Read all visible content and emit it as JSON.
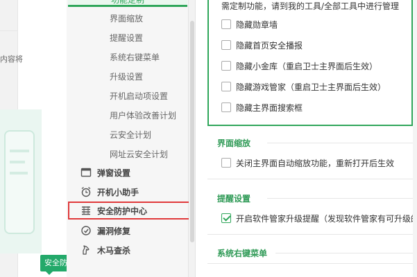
{
  "background": {
    "partial_text": "内容将",
    "badge_text": "安全防"
  },
  "sidebar": {
    "active_tab_label": "功能定制",
    "sub_items": [
      {
        "label": "界面缩放"
      },
      {
        "label": "提醒设置"
      },
      {
        "label": "系统右键菜单"
      },
      {
        "label": "升级设置"
      },
      {
        "label": "开机启动项设置"
      },
      {
        "label": "用户体验改善计划"
      },
      {
        "label": "云安全计划"
      },
      {
        "label": "网址云安全计划"
      }
    ],
    "categories": [
      {
        "label": "弹窗设置",
        "icon": "window-icon"
      },
      {
        "label": "开机小助手",
        "icon": "alarm-clock-icon"
      },
      {
        "label": "安全防护中心",
        "icon": "shield-grid-icon",
        "highlighted": true
      },
      {
        "label": "漏洞修复",
        "icon": "patch-icon"
      },
      {
        "label": "木马查杀",
        "icon": "trojan-horse-icon"
      }
    ]
  },
  "content": {
    "customize_note": "需定制功能，请到我的工具/全部工具中进行管理",
    "customize_options": [
      {
        "label": "隐藏勋章墙",
        "checked": false
      },
      {
        "label": "隐藏首页安全播报",
        "checked": false
      },
      {
        "label": "隐藏小金库（重启卫士主界面后生效）",
        "checked": false
      },
      {
        "label": "隐藏游戏管家（重启卫士主界面后生效）",
        "checked": false
      },
      {
        "label": "隐藏主界面搜索框",
        "checked": false
      }
    ],
    "sections": [
      {
        "title": "界面缩放",
        "option": {
          "label": "关闭主界面自动缩放功能，重新打开后生效",
          "checked": false
        }
      },
      {
        "title": "提醒设置",
        "option": {
          "label": "开启软件管家升级提醒（发现软件管家有可升级的",
          "checked": true
        }
      },
      {
        "title": "系统右键菜单"
      }
    ]
  },
  "colors": {
    "accent_green": "#2fa65a",
    "highlight_red": "#e0393a",
    "badge_green": "#23a96a"
  }
}
